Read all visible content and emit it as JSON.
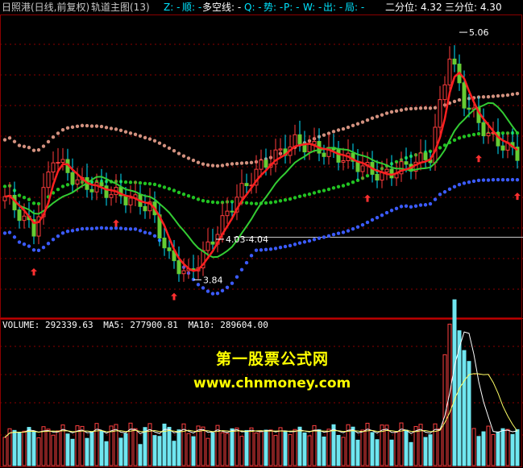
{
  "header": {
    "stock_name": "日照港(日线,前复权)",
    "indicator_name": "轨道主图(13)",
    "legend_items": [
      {
        "label": "Z: -",
        "color": "#00e5ff"
      },
      {
        "label": "顺: -",
        "color": "#00e5ff"
      },
      {
        "label": "多空线: -",
        "color": "#ffffff"
      },
      {
        "label": "Q: -",
        "color": "#00e5ff"
      },
      {
        "label": "势: -",
        "color": "#00e5ff"
      },
      {
        "label": "P: -",
        "color": "#00e5ff"
      },
      {
        "label": "W: -",
        "color": "#00e5ff"
      },
      {
        "label": "出: -",
        "color": "#00e5ff"
      },
      {
        "label": "局: -",
        "color": "#00e5ff"
      }
    ],
    "quantile2": "二分位: 4.32",
    "quantile3": "三分位: 4.30"
  },
  "volume_header": {
    "volume": "VOLUME: 292339.63",
    "ma5": "MA5: 277900.81",
    "ma10": "MA10: 289604.00"
  },
  "watermark": {
    "title": "第一股票公式网",
    "url": "www.chnmoney.com"
  },
  "colors": {
    "up": "#ff3c3c",
    "down": "#00e5ff",
    "grid": "#8b0000",
    "ma_red": "#ff2020",
    "ma_green": "#33cc33",
    "upper_band": "#d2917f",
    "mid_band": "#22c322",
    "lower_band": "#3b5bff"
  },
  "chart_data": [
    {
      "type": "candlestick",
      "annotations": [
        {
          "text": "5.06",
          "price": 5.06
        },
        {
          "text": "3.84",
          "price": 3.84
        },
        {
          "text": "4.03-4.04",
          "price": 4.04
        }
      ],
      "reference_line": 4.05,
      "price_range": [
        3.75,
        5.1
      ]
    },
    {
      "type": "bar",
      "series": [
        {
          "name": "VOLUME",
          "values": []
        },
        {
          "name": "MA5",
          "values": []
        },
        {
          "name": "MA10",
          "values": []
        }
      ]
    }
  ]
}
